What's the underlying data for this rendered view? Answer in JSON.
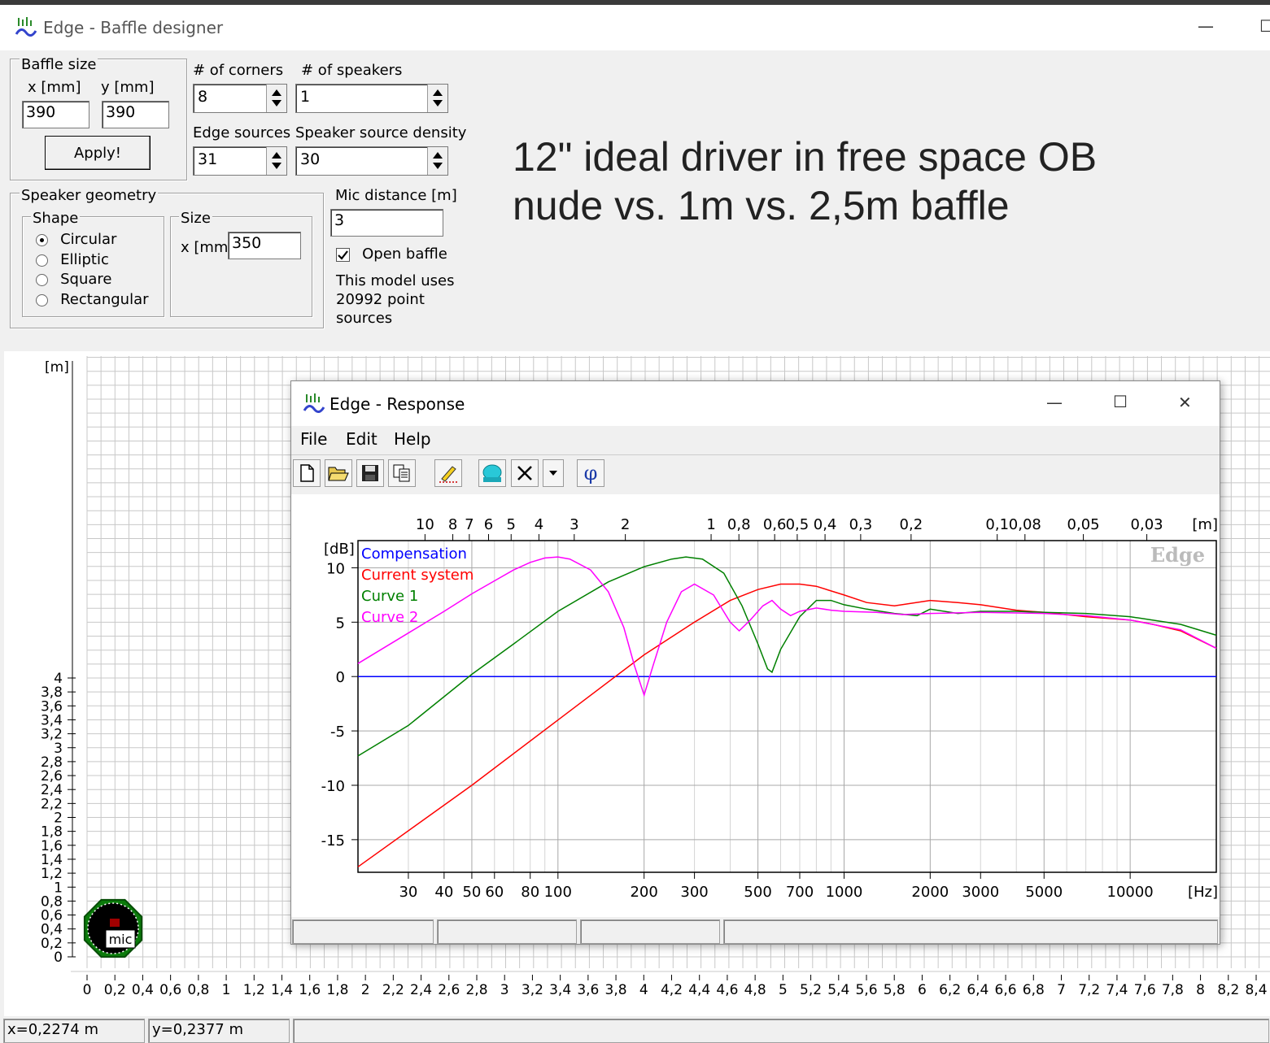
{
  "main_window": {
    "title": "Edge - Baffle designer",
    "min_glyph": "—",
    "max_glyph": "☐"
  },
  "baffle_size": {
    "group_label": "Baffle size",
    "x_label": "x [mm]",
    "y_label": "y [mm]",
    "x_value": "390",
    "y_value": "390",
    "apply_label": "Apply!"
  },
  "corners": {
    "label": "# of corners",
    "value": "8"
  },
  "speakers": {
    "label": "# of speakers",
    "value": "1"
  },
  "edge_sources": {
    "label": "Edge sources",
    "value": "31"
  },
  "source_density": {
    "label": "Speaker source density",
    "value": "30"
  },
  "speaker_geometry": {
    "group_label": "Speaker geometry",
    "shape_label": "Shape",
    "shapes": [
      "Circular",
      "Elliptic",
      "Square",
      "Rectangular"
    ],
    "selected_shape": "Circular",
    "size_label": "Size",
    "size_x_label": "x [mm]",
    "size_x_value": "350"
  },
  "mic": {
    "label": "Mic distance [m]",
    "value": "3",
    "open_baffle_label": "Open baffle",
    "open_baffle_checked": true,
    "model_text_1": "This model uses",
    "model_text_2": "20992 point",
    "model_text_3": "sources"
  },
  "annotation": {
    "line1": "12\" ideal driver in free space OB",
    "line2": "nude vs. 1m vs. 2,5m baffle"
  },
  "layout_plot": {
    "unit_label": "[m]",
    "y_ticks": [
      "4",
      "3,8",
      "3,6",
      "3,4",
      "3,2",
      "3",
      "2,8",
      "2,6",
      "2,4",
      "2,2",
      "2",
      "1,8",
      "1,6",
      "1,4",
      "1,2",
      "1",
      "0,8",
      "0,6",
      "0,4",
      "0,2",
      "0"
    ],
    "x_ticks": [
      "0",
      "0,2",
      "0,4",
      "0,6",
      "0,8",
      "1",
      "1,2",
      "1,4",
      "1,6",
      "1,8",
      "2",
      "2,2",
      "2,4",
      "2,6",
      "2,8",
      "3",
      "3,2",
      "3,4",
      "3,6",
      "3,8",
      "4",
      "4,2",
      "4,4",
      "4,6",
      "4,8",
      "5",
      "5,2",
      "5,4",
      "5,6",
      "5,8",
      "6",
      "6,2",
      "6,4",
      "6,6",
      "6,8",
      "7",
      "7,2",
      "7,4",
      "7,6",
      "7,8",
      "8",
      "8,2",
      "8,4"
    ],
    "mic_label": "mic"
  },
  "status_bar": {
    "x_readout": "x=0,2274 m",
    "y_readout": "y=0,2377 m"
  },
  "response_window": {
    "title": "Edge - Response",
    "menu": [
      "File",
      "Edit",
      "Help"
    ],
    "phi_glyph": "φ",
    "close_glyph": "✕",
    "max_glyph": "☐",
    "min_glyph": "—"
  },
  "chart_data": {
    "type": "line",
    "x_scale": "log",
    "xlim": [
      20,
      20000
    ],
    "ylim": [
      -18,
      12.5
    ],
    "ylabel": "[dB]",
    "xlabel": "[Hz]",
    "top_axis_label": "[m]",
    "watermark": "Edge",
    "x_tick_labels": [
      {
        "label": "30",
        "f": 30
      },
      {
        "label": "40",
        "f": 40
      },
      {
        "label": "50",
        "f": 50
      },
      {
        "label": "60",
        "f": 60
      },
      {
        "label": "80",
        "f": 80
      },
      {
        "label": "100",
        "f": 100
      },
      {
        "label": "200",
        "f": 200
      },
      {
        "label": "300",
        "f": 300
      },
      {
        "label": "500",
        "f": 500
      },
      {
        "label": "700",
        "f": 700
      },
      {
        "label": "1000",
        "f": 1000
      },
      {
        "label": "2000",
        "f": 2000
      },
      {
        "label": "3000",
        "f": 3000
      },
      {
        "label": "5000",
        "f": 5000
      },
      {
        "label": "10000",
        "f": 10000
      }
    ],
    "top_tick_labels": [
      {
        "label": "10",
        "f": 34.3
      },
      {
        "label": "8",
        "f": 42.9
      },
      {
        "label": "7",
        "f": 49
      },
      {
        "label": "6",
        "f": 57.2
      },
      {
        "label": "5",
        "f": 68.6
      },
      {
        "label": "4",
        "f": 85.8
      },
      {
        "label": "3",
        "f": 114
      },
      {
        "label": "2",
        "f": 172
      },
      {
        "label": "1",
        "f": 343
      },
      {
        "label": "0,8",
        "f": 429
      },
      {
        "label": "0,6",
        "f": 572
      },
      {
        "label": "0,5",
        "f": 686
      },
      {
        "label": "0,4",
        "f": 858
      },
      {
        "label": "0,3",
        "f": 1143
      },
      {
        "label": "0,2",
        "f": 1715
      },
      {
        "label": "0,1",
        "f": 3430
      },
      {
        "label": "0,08",
        "f": 4288
      },
      {
        "label": "0,05",
        "f": 6860
      },
      {
        "label": "0,03",
        "f": 11433
      }
    ],
    "y_tick_labels": [
      {
        "label": "10",
        "v": 10
      },
      {
        "label": "5",
        "v": 5
      },
      {
        "label": "0",
        "v": 0
      },
      {
        "label": "-5",
        "v": -5
      },
      {
        "label": "-10",
        "v": -10
      },
      {
        "label": "-15",
        "v": -15
      }
    ],
    "series": [
      {
        "name": "Compensation",
        "color": "#0000ff",
        "points": [
          [
            20,
            0
          ],
          [
            20000,
            0
          ]
        ]
      },
      {
        "name": "Current system",
        "color": "#ff0000",
        "points": [
          [
            20,
            -17.5
          ],
          [
            50,
            -10
          ],
          [
            100,
            -4
          ],
          [
            200,
            2
          ],
          [
            300,
            5
          ],
          [
            400,
            7
          ],
          [
            500,
            8
          ],
          [
            600,
            8.5
          ],
          [
            700,
            8.5
          ],
          [
            800,
            8.3
          ],
          [
            1000,
            7.5
          ],
          [
            1200,
            6.8
          ],
          [
            1500,
            6.5
          ],
          [
            2000,
            7
          ],
          [
            2500,
            6.8
          ],
          [
            3000,
            6.6
          ],
          [
            4000,
            6.1
          ],
          [
            5000,
            5.9
          ],
          [
            7000,
            5.5
          ],
          [
            10000,
            5.2
          ],
          [
            12000,
            4.8
          ],
          [
            15000,
            4.2
          ],
          [
            20000,
            2.6
          ]
        ]
      },
      {
        "name": "Curve 1",
        "color": "#008000",
        "points": [
          [
            20,
            -7.3
          ],
          [
            30,
            -4.5
          ],
          [
            50,
            0.2
          ],
          [
            70,
            3
          ],
          [
            100,
            6
          ],
          [
            150,
            8.7
          ],
          [
            200,
            10.1
          ],
          [
            250,
            10.8
          ],
          [
            280,
            11
          ],
          [
            320,
            10.8
          ],
          [
            380,
            9.5
          ],
          [
            440,
            6.5
          ],
          [
            500,
            3
          ],
          [
            540,
            0.7
          ],
          [
            560,
            0.4
          ],
          [
            600,
            2.5
          ],
          [
            700,
            5.5
          ],
          [
            800,
            7
          ],
          [
            900,
            7
          ],
          [
            1000,
            6.6
          ],
          [
            1200,
            6.2
          ],
          [
            1500,
            5.8
          ],
          [
            1800,
            5.6
          ],
          [
            2000,
            6.2
          ],
          [
            2500,
            5.8
          ],
          [
            3000,
            6
          ],
          [
            4000,
            6
          ],
          [
            5000,
            5.9
          ],
          [
            7000,
            5.8
          ],
          [
            10000,
            5.5
          ],
          [
            15000,
            4.8
          ],
          [
            20000,
            3.8
          ]
        ]
      },
      {
        "name": "Curve 2",
        "color": "#ff00ff",
        "points": [
          [
            20,
            1.2
          ],
          [
            30,
            4
          ],
          [
            40,
            6
          ],
          [
            50,
            7.6
          ],
          [
            60,
            8.8
          ],
          [
            70,
            9.8
          ],
          [
            80,
            10.5
          ],
          [
            90,
            10.9
          ],
          [
            100,
            11
          ],
          [
            110,
            10.8
          ],
          [
            130,
            9.8
          ],
          [
            150,
            7.8
          ],
          [
            170,
            4.5
          ],
          [
            185,
            1
          ],
          [
            200,
            -1.7
          ],
          [
            215,
            1
          ],
          [
            240,
            5
          ],
          [
            270,
            7.8
          ],
          [
            300,
            8.5
          ],
          [
            350,
            7.5
          ],
          [
            400,
            5
          ],
          [
            430,
            4.2
          ],
          [
            470,
            5.2
          ],
          [
            520,
            6.5
          ],
          [
            560,
            7
          ],
          [
            600,
            6.2
          ],
          [
            650,
            5.6
          ],
          [
            700,
            6
          ],
          [
            800,
            6.3
          ],
          [
            900,
            6.1
          ],
          [
            1000,
            6
          ],
          [
            1300,
            5.9
          ],
          [
            1600,
            5.7
          ],
          [
            2000,
            5.8
          ],
          [
            3000,
            5.9
          ],
          [
            5000,
            5.8
          ],
          [
            7000,
            5.6
          ],
          [
            10000,
            5.2
          ],
          [
            15000,
            4.3
          ],
          [
            20000,
            2.6
          ]
        ]
      }
    ]
  }
}
